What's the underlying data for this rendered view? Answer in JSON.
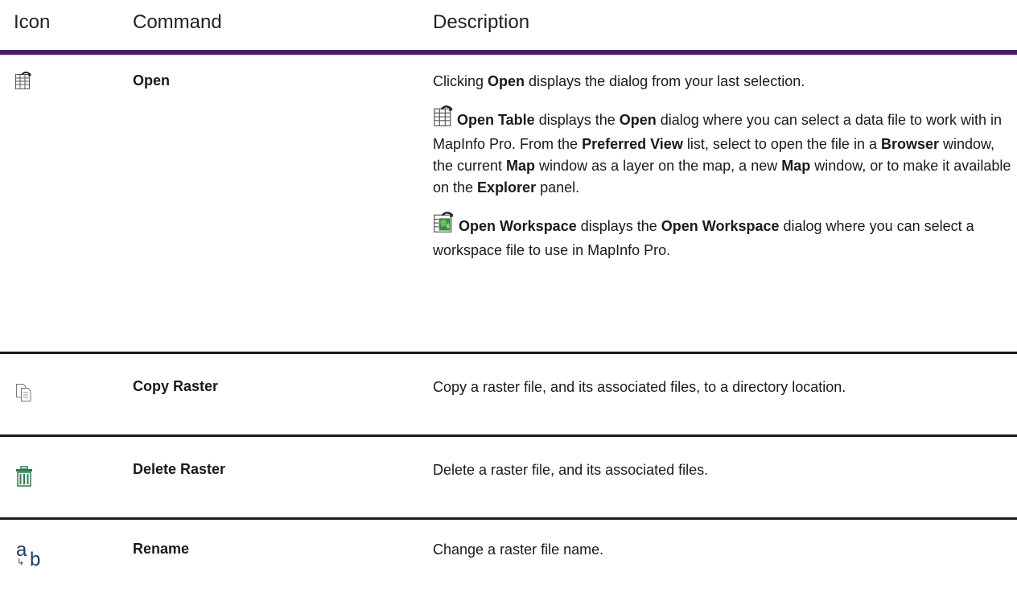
{
  "header": {
    "icon": "Icon",
    "command": "Command",
    "description": "Description"
  },
  "rows": [
    {
      "icon": "open-table-icon",
      "command": "Open",
      "desc": {
        "p1_a": "Clicking ",
        "p1_b": "Open",
        "p1_c": " displays the dialog from your last selection.",
        "p2_open_table": "Open Table",
        "p2_a": " displays the ",
        "p2_open": "Open",
        "p2_b": " dialog where you can select a data file to work with in MapInfo Pro. From the ",
        "p2_pref": "Preferred View",
        "p2_c": " list, select to open the file in a ",
        "p2_browser": "Browser",
        "p2_d": " window, the current ",
        "p2_map1": "Map",
        "p2_e": " window as a layer on the map, a new ",
        "p2_map2": "Map",
        "p2_f": " window, or to make it available on the ",
        "p2_explorer": "Explorer",
        "p2_g": " panel.",
        "p3_open_ws": "Open Workspace",
        "p3_a": " displays the ",
        "p3_open_ws2": "Open Workspace",
        "p3_b": " dialog where you can select a workspace file to use in MapInfo Pro."
      }
    },
    {
      "icon": "copy-raster-icon",
      "command": "Copy Raster",
      "desc": "Copy a raster file, and its associated files, to a directory location."
    },
    {
      "icon": "delete-raster-icon",
      "command": "Delete Raster",
      "desc": "Delete a raster file, and its associated files."
    },
    {
      "icon": "rename-icon",
      "command": "Rename",
      "desc": "Change a raster file name.",
      "glyph_a": "a",
      "glyph_b": "b",
      "glyph_arrow": "↳"
    }
  ],
  "colors": {
    "header_rule": "#4a1b6e",
    "row_rule": "#1a1a1a",
    "icon_green": "#2e7d4f",
    "icon_blue": "#1e3a6e"
  }
}
